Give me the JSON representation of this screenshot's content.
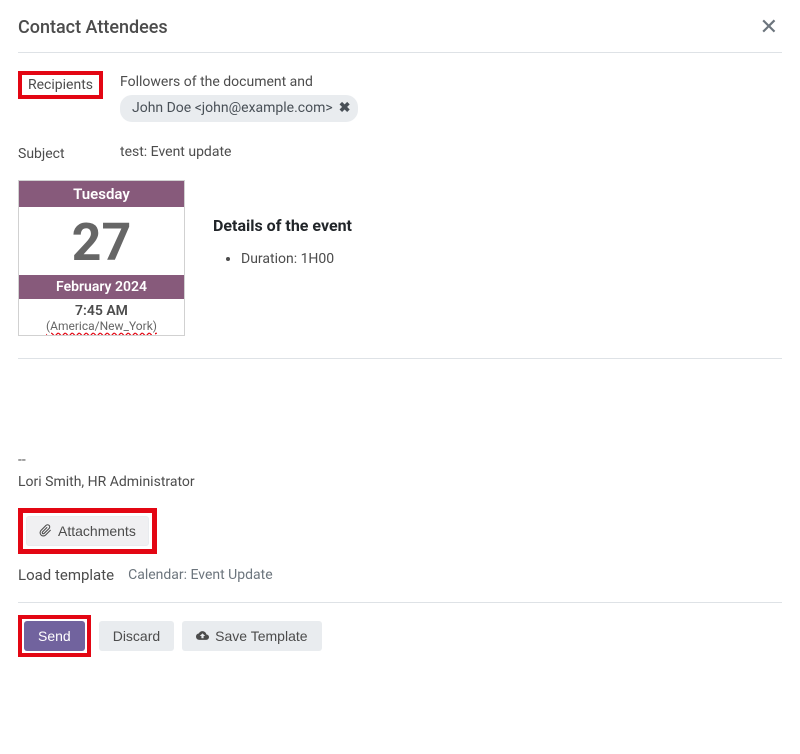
{
  "modal": {
    "title": "Contact Attendees"
  },
  "recipients": {
    "label": "Recipients",
    "followersText": "Followers of the document and",
    "chip": "John Doe <john@example.com>"
  },
  "subject": {
    "label": "Subject",
    "value": "test: Event update"
  },
  "dateCard": {
    "dayName": "Tuesday",
    "dayNum": "27",
    "monthYear": "February 2024",
    "time": "7:45 AM",
    "tz": "(America/New_York)"
  },
  "eventDetails": {
    "title": "Details of the event",
    "durationLabel": "Duration: ",
    "durationValue": "1H00"
  },
  "signature": {
    "dashes": "--",
    "line": "Lori Smith, HR Administrator"
  },
  "attachments": {
    "label": "Attachments"
  },
  "template": {
    "label": "Load template",
    "value": "Calendar: Event Update"
  },
  "buttons": {
    "send": "Send",
    "discard": "Discard",
    "saveTemplate": "Save Template"
  }
}
